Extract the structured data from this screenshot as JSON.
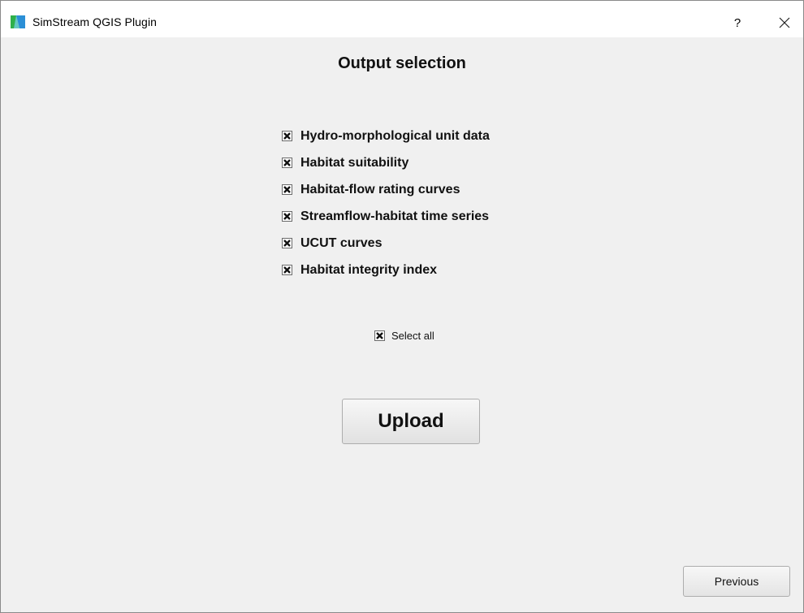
{
  "window": {
    "title": "SimStream QGIS Plugin",
    "help_label": "?",
    "close_icon": "close-icon",
    "app_icon": "simstream-logo-icon"
  },
  "main": {
    "heading": "Output selection",
    "options": [
      {
        "label": "Hydro-morphological unit data",
        "checked": true
      },
      {
        "label": "Habitat suitability",
        "checked": true
      },
      {
        "label": "Habitat-flow rating curves",
        "checked": true
      },
      {
        "label": "Streamflow-habitat time series",
        "checked": true
      },
      {
        "label": "UCUT curves",
        "checked": true
      },
      {
        "label": "Habitat integrity index",
        "checked": true
      }
    ],
    "select_all": {
      "label": "Select all",
      "checked": true
    },
    "upload_label": "Upload",
    "previous_label": "Previous"
  },
  "colors": {
    "dialog_background": "#f0f0f0",
    "titlebar_background": "#ffffff",
    "logo_green": "#2eb04a",
    "logo_blue": "#2b8fd6"
  }
}
